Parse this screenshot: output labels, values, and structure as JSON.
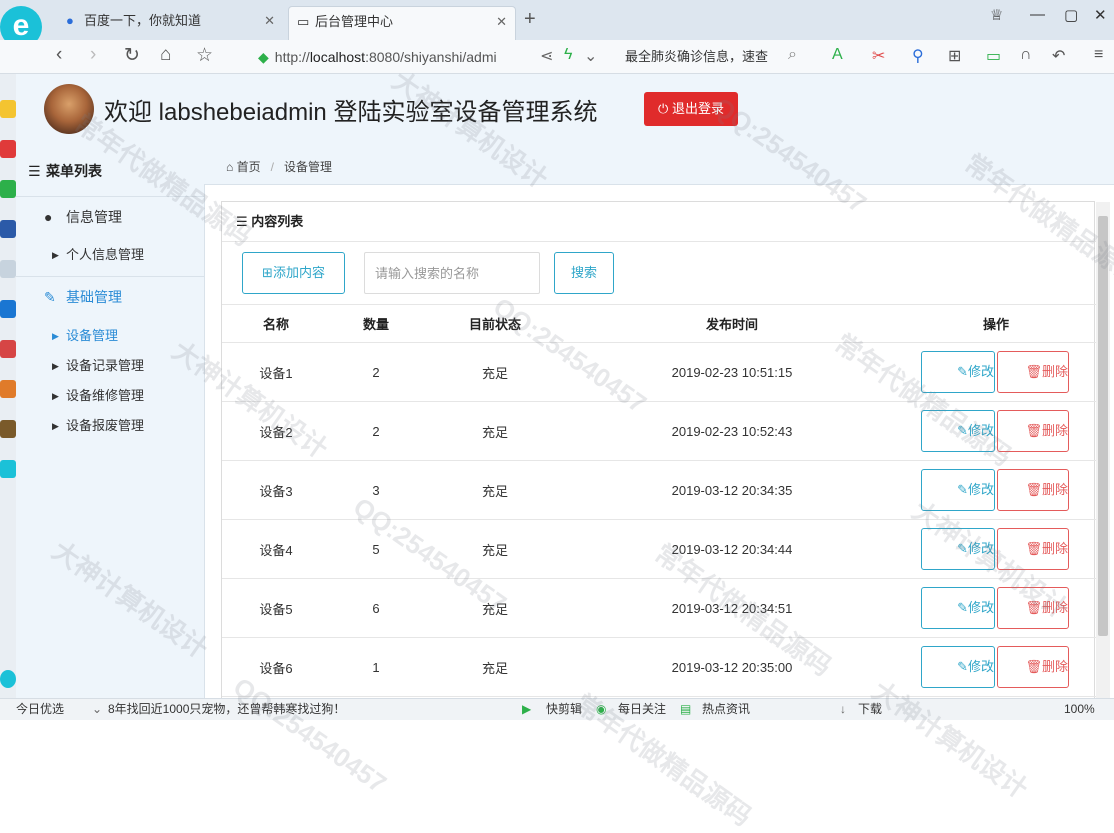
{
  "browser": {
    "tabs": [
      {
        "label": "百度一下，你就知道",
        "icon": "paw-icon"
      },
      {
        "label": "后台管理中心",
        "icon": "page-icon"
      }
    ],
    "url_prefix": "http://",
    "url_host": "localhost",
    "url_rest": ":8080/shiyanshi/admi",
    "news_text": "最全肺炎确诊信息，速查"
  },
  "header": {
    "welcome": "欢迎 labshebeiadmin 登陆实验室设备管理系统",
    "logout_label": "退出登录"
  },
  "sidebar": {
    "title": "菜单列表",
    "groups": [
      {
        "label": "信息管理",
        "items": [
          "个人信息管理"
        ]
      },
      {
        "label": "基础管理",
        "items": [
          "设备管理",
          "设备记录管理",
          "设备维修管理",
          "设备报废管理"
        ]
      }
    ]
  },
  "breadcrumb": {
    "home": "首页",
    "current": "设备管理"
  },
  "panel": {
    "title": "内容列表",
    "add_label": "添加内容",
    "search_placeholder": "请输入搜索的名称",
    "search_label": "搜索"
  },
  "table": {
    "columns": [
      "名称",
      "数量",
      "目前状态",
      "发布时间",
      "操作"
    ],
    "rows": [
      {
        "name": "设备1",
        "qty": "2",
        "status": "充足",
        "time": "2019-02-23 10:51:15"
      },
      {
        "name": "设备2",
        "qty": "2",
        "status": "充足",
        "time": "2019-02-23 10:52:43"
      },
      {
        "name": "设备3",
        "qty": "3",
        "status": "充足",
        "time": "2019-03-12 20:34:35"
      },
      {
        "name": "设备4",
        "qty": "5",
        "status": "充足",
        "time": "2019-03-12 20:34:44"
      },
      {
        "name": "设备5",
        "qty": "6",
        "status": "充足",
        "time": "2019-03-12 20:34:51"
      },
      {
        "name": "设备6",
        "qty": "1",
        "status": "充足",
        "time": "2019-03-12 20:35:00"
      }
    ],
    "edit_label": "修改",
    "delete_label": "删除"
  },
  "statusbar": {
    "left": "今日优选",
    "news": "8年找回近1000只宠物，还曾帮韩寒找过狗！",
    "items": [
      "快剪辑",
      "每日关注",
      "热点资讯",
      "下载"
    ],
    "zoom": "100%"
  },
  "watermarks": [
    "常年代做精品源码",
    "大神计算机设计",
    "QQ:254540457"
  ],
  "colors": {
    "accent": "#2fa6c9",
    "danger": "#e45b5b",
    "logout": "#e02b2b",
    "active_nav": "#2b8cd6"
  }
}
